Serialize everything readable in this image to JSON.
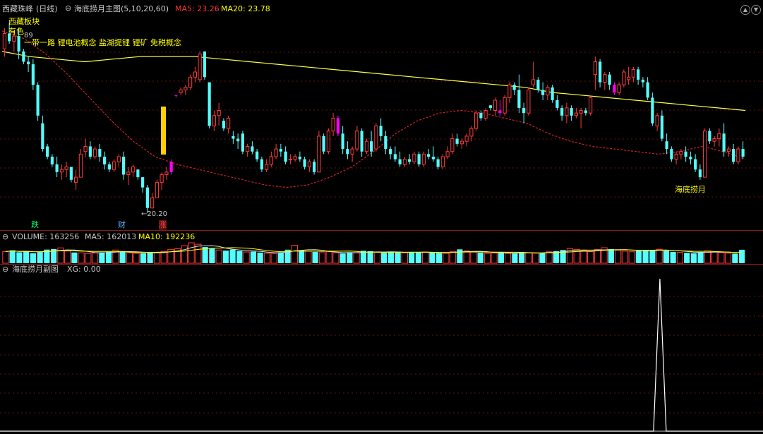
{
  "header": {
    "stock_name": "西藏珠峰",
    "period": "(日线)",
    "indicator_name": "海底捞月主图(5,10,20,60)",
    "ma5_label": "MA5: 23.26",
    "ma20_label": "MA20: 23.78"
  },
  "concepts": {
    "sector": "西藏板块",
    "metal": "有色",
    "tags": "一带一路 锂电池概念 盐湖提锂 锂矿 免税概念"
  },
  "annotations": {
    "high_price": "89",
    "low_price": "←20.20",
    "signal_label": "海底捞月",
    "event_labels": [
      "跌",
      "财",
      "涨"
    ]
  },
  "volume_panel": {
    "header": "VOLUME: 163256",
    "ma5": "MA5: 162013",
    "ma10": "MA10: 192236"
  },
  "sub_panel": {
    "header": "海底捞月副图",
    "xg": "XG: 0.00"
  },
  "colors": {
    "up": "#ff3a3a",
    "down": "#54ffff",
    "signal": "#ff00ff",
    "ma_long": "#ffff44",
    "ma_short": "#cc2222",
    "header_name": "#c8c8c8",
    "ma5_text": "#ff3333",
    "ma20_text": "#ffff00",
    "concept_text": "#ffff00",
    "grid": "#6a1010"
  },
  "chart_data": {
    "type": "candlestick",
    "price_range": [
      20.2,
      27.9
    ],
    "candles": [
      [
        26.6,
        27.4,
        26.3,
        27.2
      ],
      [
        27.2,
        27.6,
        26.8,
        26.9
      ],
      [
        26.9,
        27.3,
        26.5,
        27.1
      ],
      [
        27.1,
        27.4,
        26.2,
        26.5
      ],
      [
        26.5,
        26.6,
        26.0,
        26.1
      ],
      [
        26.1,
        26.3,
        25.7,
        26.0
      ],
      [
        26.0,
        26.2,
        25.0,
        25.2
      ],
      [
        25.2,
        25.3,
        23.8,
        24.0
      ],
      [
        23.7,
        24.0,
        22.6,
        22.7
      ],
      [
        22.8,
        22.9,
        22.3,
        22.4
      ],
      [
        22.4,
        22.5,
        22.0,
        22.1
      ],
      [
        22.1,
        22.4,
        21.6,
        21.8
      ],
      [
        21.8,
        22.1,
        21.5,
        21.9
      ],
      [
        21.9,
        22.2,
        21.6,
        22.0
      ],
      [
        22.0,
        22.0,
        21.4,
        21.5
      ],
      [
        21.4,
        21.9,
        21.1,
        21.6
      ],
      [
        21.6,
        22.7,
        21.6,
        22.5
      ],
      [
        22.6,
        23.1,
        22.4,
        22.8
      ],
      [
        22.8,
        23.0,
        22.3,
        22.4
      ],
      [
        22.4,
        22.8,
        22.3,
        22.7
      ],
      [
        22.7,
        22.9,
        22.2,
        22.4
      ],
      [
        22.4,
        22.6,
        21.9,
        22.1
      ],
      [
        22.1,
        22.2,
        21.8,
        21.9
      ],
      [
        21.9,
        22.3,
        21.8,
        22.2
      ],
      [
        22.2,
        22.5,
        22.0,
        22.4
      ],
      [
        22.4,
        22.6,
        21.5,
        21.7
      ],
      [
        21.7,
        22.0,
        21.3,
        21.8
      ],
      [
        21.8,
        22.1,
        21.6,
        22.0
      ],
      [
        21.9,
        21.9,
        21.5,
        21.6
      ],
      [
        21.6,
        21.6,
        21.0,
        21.2
      ],
      [
        21.2,
        21.3,
        20.2,
        20.4
      ],
      [
        20.4,
        21.0,
        20.4,
        20.8
      ],
      [
        20.8,
        21.5,
        20.8,
        21.4
      ],
      [
        21.4,
        21.8,
        21.1,
        21.7
      ],
      [
        21.7,
        22.0,
        21.5,
        21.8
      ],
      [
        21.8,
        22.3,
        21.7,
        22.2
      ],
      [
        24.8,
        24.8,
        24.7,
        24.8
      ],
      [
        24.9,
        25.1,
        24.8,
        25.0
      ],
      [
        25.0,
        25.2,
        24.8,
        25.1
      ],
      [
        25.1,
        25.6,
        25.0,
        25.5
      ],
      [
        25.5,
        25.9,
        25.3,
        25.7
      ],
      [
        25.4,
        26.5,
        25.3,
        26.4
      ],
      [
        26.5,
        26.5,
        25.4,
        25.5
      ],
      [
        25.3,
        25.3,
        23.5,
        23.6
      ],
      [
        23.6,
        24.2,
        23.4,
        24.0
      ],
      [
        24.0,
        24.5,
        23.6,
        24.2
      ],
      [
        23.8,
        23.9,
        23.4,
        23.5
      ],
      [
        23.5,
        24.0,
        23.3,
        23.9
      ],
      [
        23.2,
        23.4,
        22.9,
        23.1
      ],
      [
        23.1,
        23.3,
        22.7,
        23.0
      ],
      [
        23.3,
        23.4,
        22.5,
        22.6
      ],
      [
        22.6,
        22.9,
        22.4,
        22.8
      ],
      [
        22.8,
        23.0,
        22.5,
        22.6
      ],
      [
        22.6,
        22.7,
        22.2,
        22.3
      ],
      [
        22.3,
        22.4,
        21.8,
        21.9
      ],
      [
        21.9,
        22.3,
        21.8,
        22.1
      ],
      [
        22.1,
        22.6,
        22.0,
        22.4
      ],
      [
        22.4,
        22.9,
        22.3,
        22.7
      ],
      [
        22.7,
        22.9,
        22.4,
        22.6
      ],
      [
        22.6,
        22.8,
        22.1,
        22.2
      ],
      [
        22.3,
        22.5,
        22.1,
        22.3
      ],
      [
        22.3,
        22.5,
        22.2,
        22.4
      ],
      [
        22.4,
        22.6,
        22.2,
        22.3
      ],
      [
        22.3,
        22.4,
        21.9,
        22.0
      ],
      [
        22.0,
        22.3,
        21.8,
        22.2
      ],
      [
        22.2,
        22.3,
        21.7,
        21.8
      ],
      [
        21.8,
        23.4,
        21.8,
        23.2
      ],
      [
        23.2,
        23.3,
        22.5,
        22.6
      ],
      [
        22.6,
        23.5,
        22.5,
        23.4
      ],
      [
        23.4,
        24.1,
        23.2,
        23.9
      ],
      [
        23.9,
        24.0,
        23.2,
        23.3
      ],
      [
        23.3,
        23.6,
        22.5,
        22.7
      ],
      [
        22.7,
        23.0,
        22.3,
        22.5
      ],
      [
        22.5,
        22.8,
        22.2,
        22.7
      ],
      [
        22.7,
        23.6,
        22.6,
        23.4
      ],
      [
        23.4,
        23.5,
        22.4,
        22.6
      ],
      [
        22.6,
        23.1,
        22.5,
        23.0
      ],
      [
        23.0,
        23.4,
        22.4,
        22.6
      ],
      [
        22.7,
        23.7,
        22.6,
        23.6
      ],
      [
        23.6,
        23.9,
        23.0,
        23.2
      ],
      [
        23.2,
        23.4,
        22.5,
        22.7
      ],
      [
        22.7,
        22.8,
        22.3,
        22.5
      ],
      [
        22.5,
        22.8,
        22.2,
        22.3
      ],
      [
        22.3,
        22.6,
        22.0,
        22.1
      ],
      [
        22.1,
        22.4,
        22.0,
        22.3
      ],
      [
        22.3,
        22.5,
        22.1,
        22.2
      ],
      [
        22.2,
        22.6,
        22.1,
        22.5
      ],
      [
        22.5,
        22.6,
        22.0,
        22.1
      ],
      [
        22.1,
        22.6,
        22.0,
        22.5
      ],
      [
        22.5,
        22.7,
        22.3,
        22.4
      ],
      [
        22.4,
        22.8,
        22.2,
        22.3
      ],
      [
        22.3,
        22.4,
        21.9,
        22.0
      ],
      [
        22.0,
        22.5,
        21.9,
        22.4
      ],
      [
        22.4,
        22.8,
        22.3,
        22.6
      ],
      [
        22.6,
        23.3,
        22.5,
        23.1
      ],
      [
        23.1,
        23.3,
        22.8,
        22.9
      ],
      [
        22.9,
        23.1,
        22.7,
        23.0
      ],
      [
        23.0,
        23.3,
        22.8,
        23.2
      ],
      [
        23.2,
        23.6,
        23.0,
        23.5
      ],
      [
        23.5,
        24.2,
        23.4,
        24.1
      ],
      [
        24.1,
        24.2,
        23.8,
        23.9
      ],
      [
        23.9,
        24.3,
        23.8,
        24.2
      ],
      [
        24.4,
        24.4,
        24.2,
        24.3
      ],
      [
        24.2,
        24.7,
        24.0,
        24.6
      ],
      [
        24.2,
        24.6,
        24.0,
        24.1
      ],
      [
        24.1,
        24.8,
        24.0,
        24.7
      ],
      [
        24.7,
        25.3,
        24.5,
        25.2
      ],
      [
        25.2,
        25.3,
        24.8,
        25.0
      ],
      [
        25.0,
        25.6,
        24.1,
        24.3
      ],
      [
        24.3,
        24.5,
        23.7,
        24.1
      ],
      [
        24.1,
        25.1,
        24.0,
        25.0
      ],
      [
        25.2,
        26.1,
        25.1,
        25.4
      ],
      [
        25.4,
        25.5,
        24.9,
        25.0
      ],
      [
        25.0,
        25.3,
        24.6,
        24.8
      ],
      [
        24.8,
        25.2,
        24.6,
        25.1
      ],
      [
        25.1,
        25.2,
        24.5,
        24.6
      ],
      [
        24.6,
        24.8,
        24.2,
        24.3
      ],
      [
        24.3,
        24.4,
        23.8,
        24.0
      ],
      [
        24.0,
        24.5,
        23.7,
        24.3
      ],
      [
        24.3,
        24.4,
        23.8,
        24.0
      ],
      [
        24.0,
        24.3,
        23.9,
        24.1
      ],
      [
        24.1,
        24.3,
        23.5,
        24.2
      ],
      [
        24.2,
        24.3,
        24.0,
        24.1
      ],
      [
        24.1,
        24.8,
        24.0,
        24.7
      ],
      [
        25.6,
        26.3,
        25.0,
        26.1
      ],
      [
        26.1,
        26.2,
        25.1,
        25.3
      ],
      [
        25.3,
        25.7,
        25.0,
        25.6
      ],
      [
        25.6,
        25.7,
        25.0,
        25.2
      ],
      [
        25.2,
        25.3,
        24.8,
        24.9
      ],
      [
        24.9,
        25.3,
        24.8,
        25.2
      ],
      [
        25.2,
        25.8,
        25.1,
        25.7
      ],
      [
        25.4,
        25.9,
        25.2,
        25.5
      ],
      [
        25.5,
        25.9,
        25.3,
        25.8
      ],
      [
        25.8,
        25.9,
        25.2,
        25.4
      ],
      [
        25.4,
        25.5,
        25.1,
        25.3
      ],
      [
        25.3,
        25.5,
        24.6,
        24.7
      ],
      [
        24.7,
        24.9,
        23.6,
        23.7
      ],
      [
        23.6,
        24.1,
        23.4,
        24.0
      ],
      [
        24.0,
        24.2,
        23.0,
        23.1
      ],
      [
        23.0,
        23.3,
        22.5,
        22.7
      ],
      [
        22.7,
        22.8,
        22.2,
        22.3
      ],
      [
        22.3,
        22.6,
        22.1,
        22.5
      ],
      [
        22.5,
        22.7,
        22.3,
        22.6
      ],
      [
        22.6,
        22.8,
        22.2,
        22.4
      ],
      [
        22.4,
        22.6,
        22.1,
        22.3
      ],
      [
        22.3,
        22.5,
        21.8,
        21.9
      ],
      [
        21.9,
        22.1,
        21.5,
        21.6
      ],
      [
        21.6,
        23.5,
        21.6,
        23.4
      ],
      [
        23.4,
        23.5,
        22.9,
        23.0
      ],
      [
        23.0,
        23.2,
        22.8,
        23.1
      ],
      [
        23.1,
        23.5,
        22.8,
        23.3
      ],
      [
        23.3,
        23.7,
        22.4,
        22.6
      ],
      [
        22.6,
        22.8,
        22.4,
        22.7
      ],
      [
        22.7,
        22.9,
        22.1,
        22.2
      ],
      [
        22.2,
        22.8,
        22.1,
        22.7
      ],
      [
        22.7,
        23.0,
        22.3,
        22.4
      ]
    ],
    "signal_candles": [
      35,
      36,
      70,
      104,
      128,
      161
    ],
    "ma_long": [
      26.5,
      26.3,
      26.2,
      26.1,
      26.2,
      26.3,
      26.3,
      26.3,
      26.2,
      26.1,
      26.0,
      25.9,
      25.8,
      25.7,
      25.6,
      25.5,
      25.4,
      25.3,
      25.2,
      25.1,
      24.9,
      24.8,
      24.7,
      24.6,
      24.5,
      24.4,
      24.3,
      24.2
    ],
    "ma_short": [
      27.3,
      27.0,
      26.4,
      25.6,
      24.7,
      23.8,
      23.0,
      22.4,
      22.1,
      21.9,
      21.7,
      21.5,
      21.3,
      21.2,
      21.3,
      21.6,
      22.0,
      22.6,
      23.3,
      23.8,
      24.1,
      24.2,
      24.1,
      23.9,
      23.7,
      23.3,
      23.0,
      22.8,
      22.7,
      22.6,
      22.5,
      22.6,
      22.8,
      22.6,
      22.3
    ],
    "volume": [
      142000,
      156000,
      133000,
      148000,
      121000,
      135000,
      165000,
      172000,
      186000,
      148000,
      130000,
      126000,
      118000,
      124000,
      132000,
      139000,
      160000,
      147000,
      126000,
      119000,
      122000,
      134000,
      128000,
      140000,
      168000,
      175000,
      212000,
      248000,
      230000,
      196000,
      178000,
      160000,
      153000,
      166000,
      148000,
      136000,
      142000,
      129000,
      120000,
      118000,
      131000,
      164000,
      218000,
      156000,
      146000,
      138000,
      128000,
      140000,
      126000,
      119000,
      133000,
      124000,
      151000,
      146000,
      133000,
      127000,
      138000,
      141000,
      125000,
      131000,
      128000,
      136000,
      133000,
      124000,
      120000,
      142000,
      168000,
      150000,
      136000,
      128000,
      118000,
      124000,
      130000,
      120000,
      118000,
      134000,
      126000,
      121000,
      128000,
      139000,
      146000,
      160000,
      178000,
      168000,
      150000,
      140000,
      166000,
      188000,
      172000,
      158000,
      146000,
      139000,
      150000,
      162000,
      158000,
      170000,
      152000,
      138000,
      132000,
      126000,
      120000,
      136000,
      150000,
      141000,
      129000,
      122000,
      117000,
      163256
    ],
    "volume_ma5": 162013,
    "volume_ma10": 192236,
    "xg_signal": {
      "x_fraction": 0.885,
      "value": 1,
      "current": 0.0
    }
  }
}
